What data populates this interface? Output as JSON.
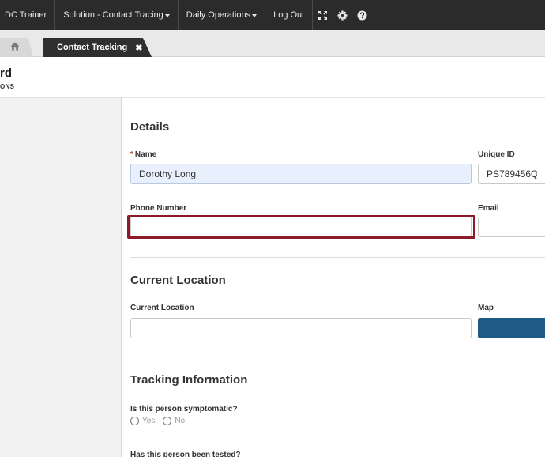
{
  "topbar": {
    "items": [
      {
        "label": "DC Trainer",
        "dropdown": false
      },
      {
        "label": "Solution - Contact Tracing",
        "dropdown": true
      },
      {
        "label": "Daily Operations",
        "dropdown": true
      },
      {
        "label": "Log Out",
        "dropdown": false
      }
    ],
    "icons": [
      "fullscreen-icon",
      "gear-icon",
      "help-icon"
    ]
  },
  "tabs": {
    "home_icon": "home-icon",
    "active_label": "Contact Tracking",
    "close_glyph": "✖"
  },
  "header": {
    "title": "rd",
    "subtitle": "ONS"
  },
  "details": {
    "section_title": "Details",
    "name_label": "Name",
    "name_required_marker": "*",
    "name_value": "Dorothy Long",
    "unique_id_label": "Unique ID",
    "unique_id_value": "PS789456Q",
    "phone_label": "Phone Number",
    "phone_value": "",
    "email_label": "Email",
    "email_value": ""
  },
  "location": {
    "section_title": "Current Location",
    "field_label": "Current Location",
    "field_value": "",
    "map_label": "Map"
  },
  "tracking": {
    "section_title": "Tracking Information",
    "symptomatic_question": "Is this person symptomatic?",
    "symptomatic_options": [
      "Yes",
      "No"
    ],
    "tested_question": "Has this person been tested?"
  },
  "colors": {
    "topbar_bg": "#2b2b2b",
    "highlight_border": "#8b1a2b",
    "map_button": "#1d5a85",
    "filled_input_bg": "#e8f0fe",
    "required_marker": "#c0392b"
  }
}
